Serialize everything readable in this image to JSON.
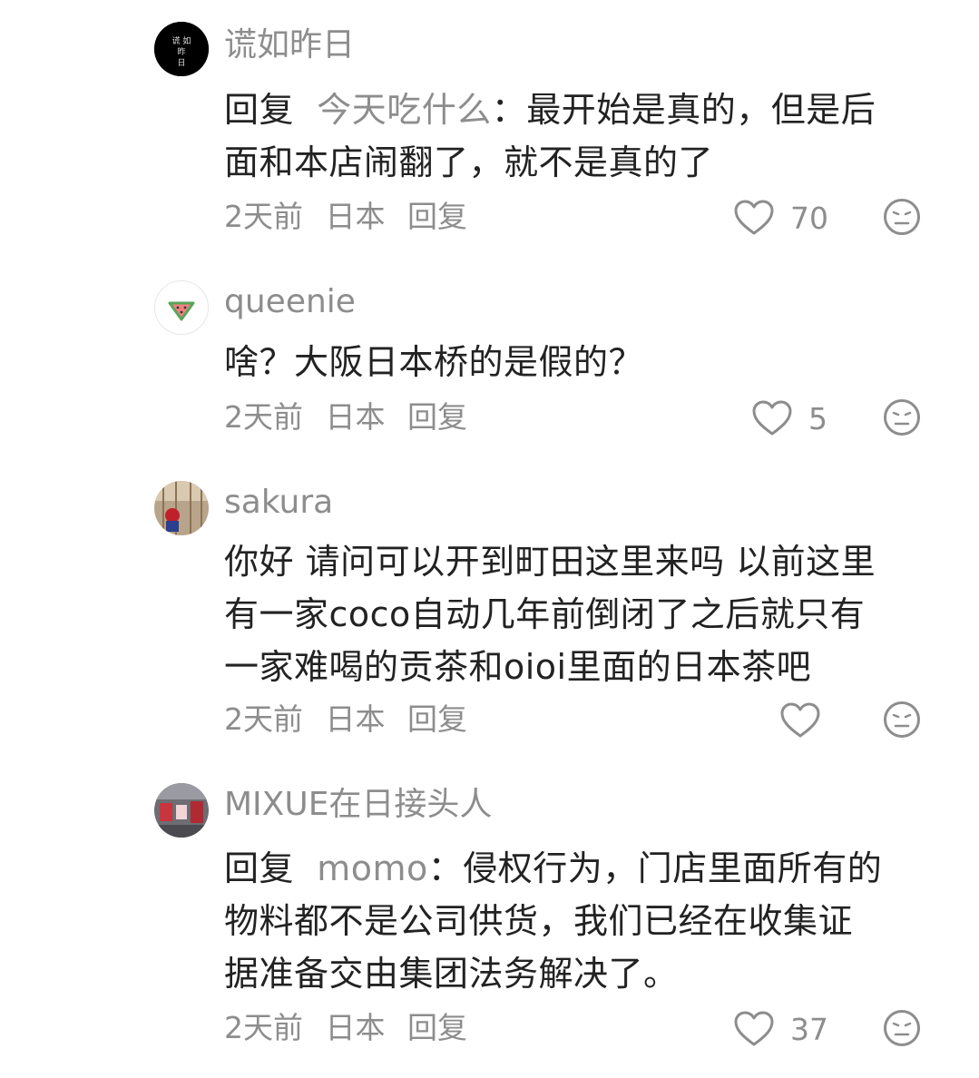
{
  "comments": [
    {
      "username": "谎如昨日",
      "reply_prefix": "回复",
      "reply_target": "今天吃什么",
      "text_line1": "最开始是真的，但是后",
      "text_line2": "面和本店闹翻了，就不是真的了",
      "time": "2天前",
      "location": "日本",
      "reply_label": "回复",
      "likes": "70"
    },
    {
      "username": "queenie",
      "text": "啥？大阪日本桥的是假的？",
      "time": "2天前",
      "location": "日本",
      "reply_label": "回复",
      "likes": "5"
    },
    {
      "username": "sakura",
      "text_line1": "你好 请问可以开到町田这里来吗 以前这里",
      "text_line2": "有一家coco自动几年前倒闭了之后就只有",
      "text_line3": "一家难喝的贡茶和oioi里面的日本茶吧",
      "time": "2天前",
      "location": "日本",
      "reply_label": "回复",
      "likes": ""
    },
    {
      "username": "MIXUE在日接头人",
      "reply_prefix": "回复",
      "reply_target": "momo",
      "text_line1": "侵权行为，门店里面所有的",
      "text_line2": "物料都不是公司供货，我们已经在收集证",
      "text_line3": "据准备交由集团法务解决了。",
      "time": "2天前",
      "location": "日本",
      "reply_label": "回复",
      "likes": "37"
    }
  ],
  "icons": {
    "like": "heart-outline-icon",
    "dislike": "meh-face-icon"
  },
  "colors": {
    "text": "#222222",
    "secondary": "#8d8d8d"
  }
}
